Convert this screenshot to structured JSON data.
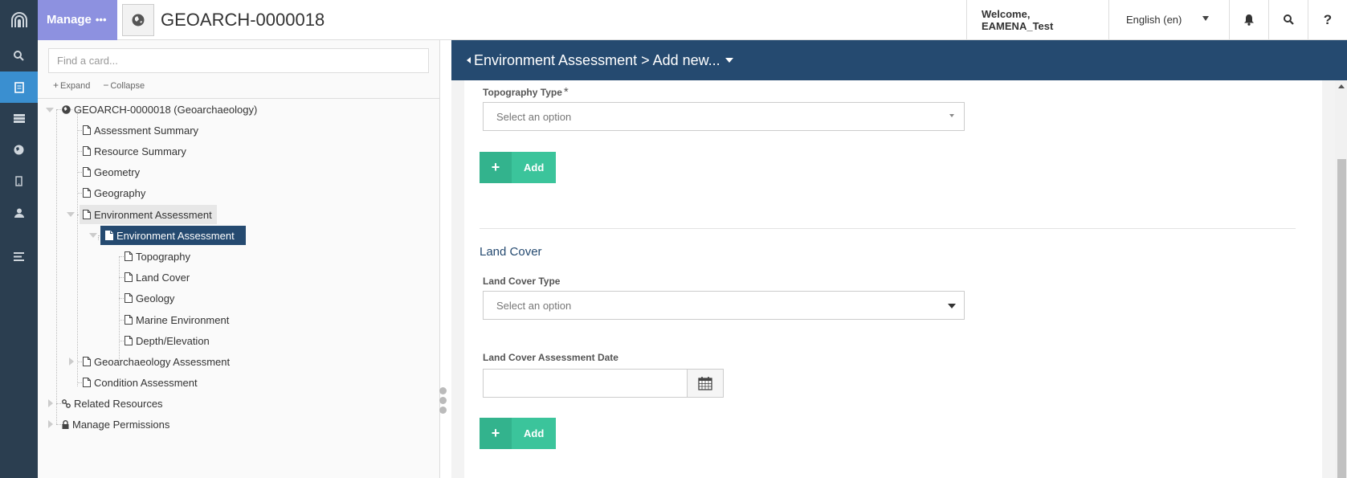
{
  "rail": {
    "icons": [
      "arches-logo-icon",
      "search-icon",
      "resource-editor-icon",
      "list-icon",
      "map-globe-icon",
      "mobile-icon",
      "user-icon",
      "menu-lines-icon"
    ]
  },
  "topbar": {
    "manage_label": "Manage",
    "manage_dots": "•••",
    "resource_title": "GEOARCH-0000018",
    "welcome": "Welcome, EAMENA_Test",
    "language": "English (en)",
    "help_label": "?"
  },
  "tree": {
    "search_placeholder": "Find a card...",
    "expand_label": "Expand",
    "collapse_label": "Collapse",
    "root": "GEOARCH-0000018 (Geoarchaeology)",
    "items": [
      "Assessment Summary",
      "Resource Summary",
      "Geometry",
      "Geography",
      "Environment Assessment",
      "Environment Assessment",
      "Topography",
      "Land Cover",
      "Geology",
      "Marine Environment",
      "Depth/Elevation",
      "Geoarchaeology Assessment",
      "Condition Assessment",
      "Related Resources",
      "Manage Permissions"
    ]
  },
  "form": {
    "breadcrumb": "Environment Assessment > Add new...",
    "topography_type_label": "Topography Type",
    "required_mark": "*",
    "topography_placeholder": "Select an option",
    "add_label": "Add",
    "land_cover_section": "Land Cover",
    "land_cover_type_label": "Land Cover Type",
    "land_cover_placeholder": "Select an option",
    "land_cover_date_label": "Land Cover Assessment Date",
    "add_label_2": "Add"
  },
  "colors": {
    "rail_bg": "#2b3e50",
    "rail_active": "#3a8fd0",
    "manage_bg": "#8d91e0",
    "header_bg": "#254a70",
    "add_green": "#3bc49b"
  }
}
